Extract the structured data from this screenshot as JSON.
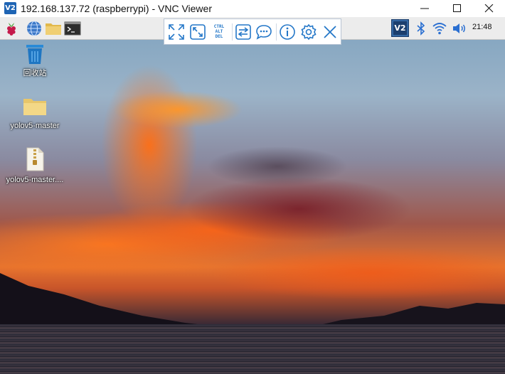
{
  "window": {
    "logo": "V2",
    "title": "192.168.137.72 (raspberrypi) - VNC Viewer",
    "controls": [
      "minimize-icon",
      "maximize-icon",
      "close-icon"
    ]
  },
  "rpi_panel": {
    "left_icons": [
      "raspberry-menu-icon",
      "web-browser-icon",
      "file-manager-icon",
      "terminal-icon"
    ],
    "right_icons": [
      "vnc-server-icon",
      "bluetooth-icon",
      "wifi-icon",
      "volume-icon"
    ],
    "clock": "21:48",
    "vnc_logo": "V2"
  },
  "vnc_toolbar": {
    "buttons": [
      "full-screen-icon",
      "scale-icon",
      "ctrl-alt-del-icon",
      "transfer-files-icon",
      "chat-icon",
      "info-icon",
      "settings-icon",
      "close-toolbar-icon"
    ],
    "ctrl_alt_del": [
      "CTRL",
      "ALT",
      "DEL"
    ]
  },
  "desktop": {
    "icons": [
      {
        "label": "回收站",
        "icon": "trash-bin-icon"
      },
      {
        "label": "yolov5-master",
        "icon": "folder-icon"
      },
      {
        "label": "yolov5-master....",
        "icon": "zip-archive-icon"
      }
    ],
    "accent": "#1e64b4"
  }
}
